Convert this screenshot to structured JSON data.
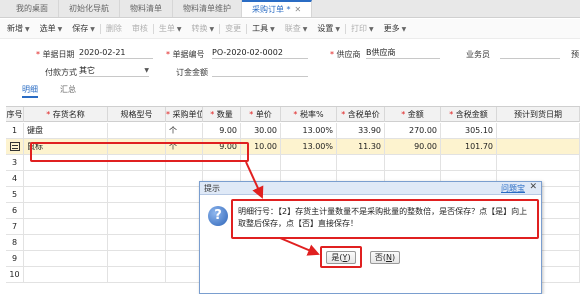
{
  "tabs": [
    {
      "label": "我的桌面"
    },
    {
      "label": "初始化导航"
    },
    {
      "label": "物料清单"
    },
    {
      "label": "物料清单维护"
    },
    {
      "label": "采购订单 *",
      "close": "✕"
    }
  ],
  "toolbar": [
    {
      "label": "新增",
      "caret": true,
      "disabled": false
    },
    {
      "label": "选单",
      "caret": true,
      "disabled": false
    },
    {
      "label": "保存",
      "caret": true,
      "disabled": false
    },
    {
      "label": "删除",
      "caret": false,
      "disabled": true
    },
    {
      "label": "审核",
      "caret": false,
      "disabled": true
    },
    {
      "label": "生单",
      "caret": true,
      "disabled": true
    },
    {
      "label": "转换",
      "caret": true,
      "disabled": true
    },
    {
      "label": "变更",
      "caret": false,
      "disabled": true
    },
    {
      "label": "工具",
      "caret": true,
      "disabled": false
    },
    {
      "label": "联查",
      "caret": true,
      "disabled": true
    },
    {
      "label": "设置",
      "caret": true,
      "disabled": false
    },
    {
      "label": "打印",
      "caret": true,
      "disabled": true
    },
    {
      "label": "更多",
      "caret": true,
      "disabled": false
    }
  ],
  "form": {
    "date_label": "单据日期",
    "date_value": "2020-02-21",
    "docno_label": "单据编号",
    "docno_value": "PO-2020-02-0002",
    "vendor_label": "供应商",
    "vendor_value": "B供应商",
    "clerk_label": "业务员",
    "clerk_value": "",
    "extra_label": "预",
    "payment_label": "付款方式",
    "payment_value": "其它",
    "deposit_label": "订金金额",
    "deposit_value": ""
  },
  "subtabs": {
    "detail": "明细",
    "summary": "汇总"
  },
  "grid": {
    "headers": [
      "序号",
      "存货名称",
      "规格型号",
      "采购单位",
      "数量",
      "单价",
      "税率%",
      "含税单价",
      "金额",
      "含税金额",
      "预计到货日期"
    ],
    "required": [
      false,
      true,
      false,
      true,
      true,
      true,
      true,
      true,
      true,
      true,
      false
    ],
    "rows": [
      {
        "idx": "1",
        "name": "键盘",
        "spec": "",
        "unit": "个",
        "qty": "9.00",
        "price": "30.00",
        "tax": "13.00%",
        "taxprice": "33.90",
        "amount": "270.00",
        "taxamount": "305.10",
        "date": ""
      },
      {
        "idx": "",
        "name": "鼠标",
        "spec": "",
        "unit": "个",
        "qty": "9.00",
        "price": "10.00",
        "tax": "13.00%",
        "taxprice": "11.30",
        "amount": "90.00",
        "taxamount": "101.70",
        "date": ""
      },
      {
        "idx": "3"
      },
      {
        "idx": "4"
      },
      {
        "idx": "5"
      },
      {
        "idx": "6"
      },
      {
        "idx": "7"
      },
      {
        "idx": "8"
      },
      {
        "idx": "9"
      },
      {
        "idx": "10"
      }
    ]
  },
  "dialog": {
    "title": "提示",
    "help": "问题宝",
    "close": "✕",
    "icon": "question-icon",
    "message": "明细行号：【2】存货主计量数量不是采购批量的整数倍，是否保存？点【是】向上取整后保存，点【否】直接保存！",
    "yes_label": "是",
    "yes_key": "Y",
    "no_label": "否",
    "no_key": "N"
  },
  "colors": {
    "accent": "#2a6cc4",
    "annotation": "#e02020",
    "selected_row": "#fdf3cf"
  }
}
